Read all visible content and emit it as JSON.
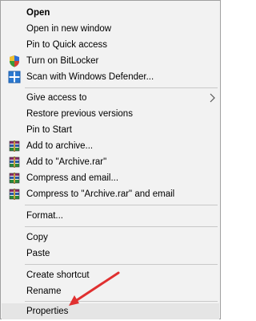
{
  "menu": {
    "items": [
      {
        "label": "Open"
      },
      {
        "label": "Open in new window"
      },
      {
        "label": "Pin to Quick access"
      },
      {
        "label": "Turn on BitLocker"
      },
      {
        "label": "Scan with Windows Defender..."
      },
      {
        "label": "Give access to"
      },
      {
        "label": "Restore previous versions"
      },
      {
        "label": "Pin to Start"
      },
      {
        "label": "Add to archive..."
      },
      {
        "label": "Add to \"Archive.rar\""
      },
      {
        "label": "Compress and email..."
      },
      {
        "label": "Compress to \"Archive.rar\" and email"
      },
      {
        "label": "Format..."
      },
      {
        "label": "Copy"
      },
      {
        "label": "Paste"
      },
      {
        "label": "Create shortcut"
      },
      {
        "label": "Rename"
      },
      {
        "label": "Properties"
      }
    ]
  },
  "icons": {
    "bitlocker": "shield-icon",
    "defender": "windows-defender-icon",
    "winrar": "winrar-books-icon",
    "submenu": "chevron-right-icon",
    "annotation": "red-arrow-icon"
  },
  "colors": {
    "menu_bg": "#f2f2f2",
    "separator": "#c8c8c8",
    "highlight": "#e5e5e5",
    "annotation_arrow": "#e03030"
  }
}
